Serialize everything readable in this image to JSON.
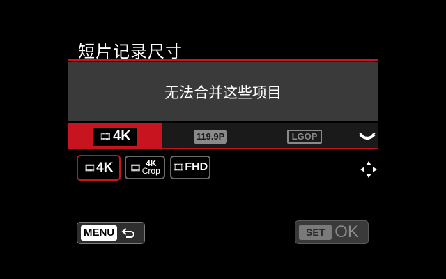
{
  "header": {
    "title": "短片记录尺寸"
  },
  "message": {
    "text": "无法合并这些项目"
  },
  "tabs": [
    {
      "label": "4K",
      "icon": "film-icon",
      "state": "active"
    },
    {
      "label": "119.9P",
      "state": "inactive"
    },
    {
      "label": "LGOP",
      "state": "inactive"
    }
  ],
  "options": [
    {
      "label": "4K",
      "icon": "film-icon",
      "selected": true
    },
    {
      "label_top": "4K",
      "label_bottom": "Crop",
      "icon": "film-icon",
      "selected": false
    },
    {
      "label": "FHD",
      "icon": "film-icon",
      "selected": false
    }
  ],
  "controls": {
    "dial_icon": "main-dial-icon",
    "cross_icon": "cross-keys-icon"
  },
  "footer": {
    "menu_label": "MENU",
    "menu_icon": "return-arrow-icon",
    "set_label": "SET",
    "ok_label": "OK"
  },
  "colors": {
    "accent": "#c8141e",
    "panel": "#3a3a3a",
    "background": "#000000"
  }
}
